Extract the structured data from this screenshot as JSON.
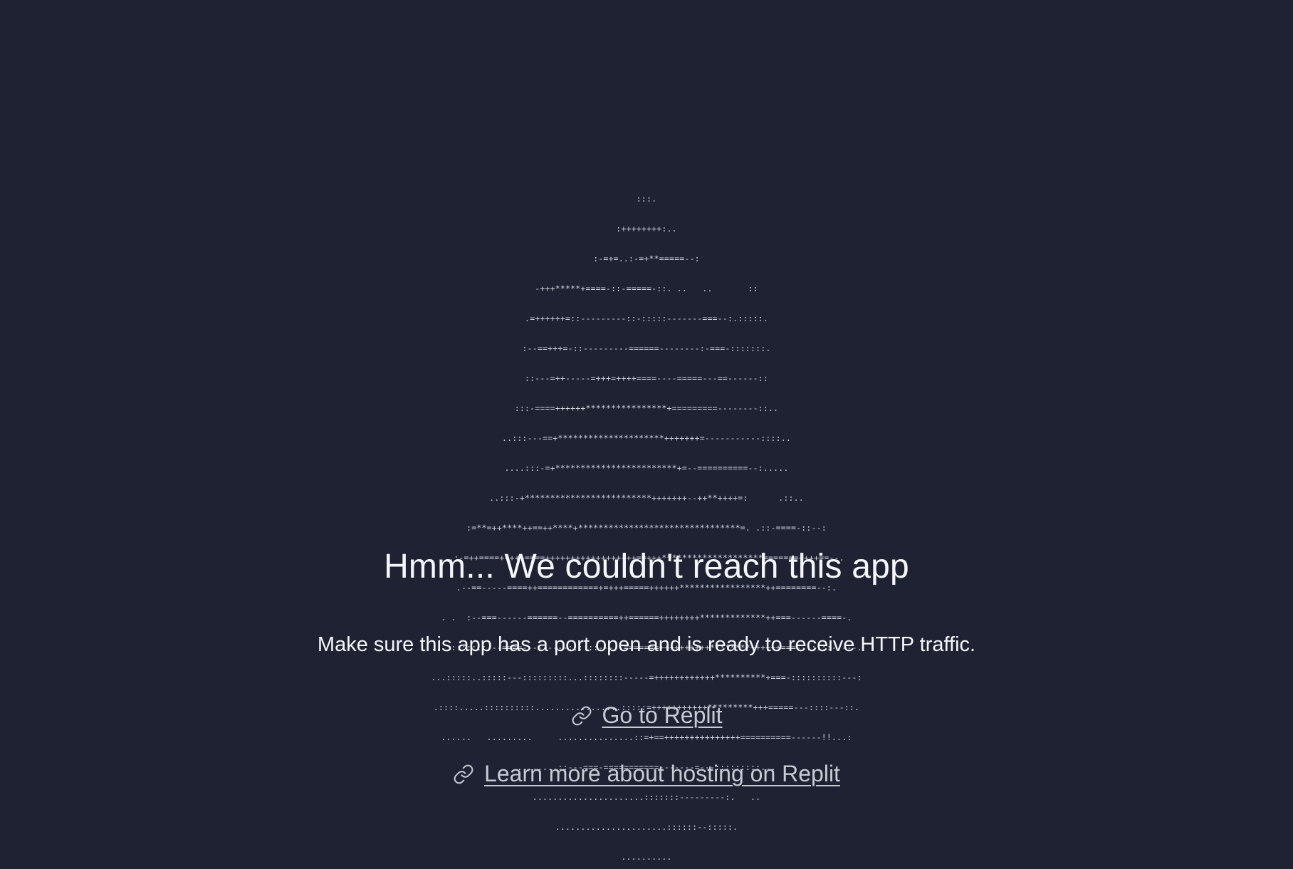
{
  "ascii_art": {
    "lines": [
      ":::.",
      ":++++++++:..",
      ":-=+=..:-=+**=====--:",
      "-+++*****+====-::-=====-::. ..   ..       ::",
      ".=++++++=::---------::-:::::-------===--:.:::::.",
      ":--==+++=-::---------======--------:-===-:::::::.",
      "::---=++-----=+++=++++====----=====---==------::",
      ":::-====++++++****************+=========--------::..",
      "..:::---==+*********************+++++++=-----------::::..",
      "....:::-=+************************+=--==========--:.....",
      "..:::-+*************************+++++++--++**++++=:      .::..",
      ":=**=++****++==++****+********************************=. .::-====-::--:",
      ".:-=++====+++++====++++++++++++++++++==+++********************=======++++==--.",
      ".--==-----====++============+=+++=====++++++*****************++========--:.",
      ". .  :--===------======--==========++======++++++++*************++===------====-.",
      "...::::::::---====---------::::::-----=======++++++++++********++++++===--:::::-----.",
      "...:::::..:::::---:::::::::...::::::::-----=++++++++++++**********+===-::::::::::---:",
      ".::::.....::::::::::.................:::::=+++++++++++*********+++=====---::::---::.",
      "......   .........     ...............::=+==+++++++++++++++==========------!!...:",
      "........::---===-===========-------=---:::::::::...",
      "......................:::::::---------:.   ..",
      "......................::::::--:::::.",
      ".........."
    ]
  },
  "heading": "Hmm... We couldn't reach this app",
  "subtext": "Make sure this app has a port open and is ready to receive HTTP traffic.",
  "links": [
    {
      "label": "Go to Replit",
      "icon": "link-icon"
    },
    {
      "label": "Learn more about hosting on Replit",
      "icon": "link-icon"
    }
  ],
  "colors": {
    "background": "#1f2233",
    "text": "#f5f7fa",
    "link": "#c7cbd4",
    "ascii": "#cfd3dc"
  }
}
